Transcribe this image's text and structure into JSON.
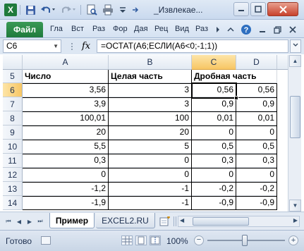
{
  "window": {
    "app_icon_letter": "X",
    "title": "_Извлекае...",
    "controls": {
      "minimize": "—",
      "maximize": "☐",
      "close": "✕"
    }
  },
  "quick_access": {
    "icons": [
      "save-icon",
      "undo-icon",
      "redo-icon",
      "print-preview-icon",
      "print-icon",
      "customize-qat-icon"
    ]
  },
  "ribbon": {
    "file_tab": "Файл",
    "tabs": [
      "Гла",
      "Вст",
      "Раз",
      "Фор",
      "Дая",
      "Рец",
      "Вид",
      "Раз"
    ],
    "right_icons": [
      "ribbon-scroll-icon",
      "help-icon",
      "minimize-ribbon-icon",
      "restore-icon",
      "close-doc-icon"
    ]
  },
  "formula_bar": {
    "name_box": "C6",
    "fx_label": "fx",
    "formula": "=ОСТАТ(A6;ЕСЛИ(A6<0;-1;1))"
  },
  "grid": {
    "columns": [
      "A",
      "B",
      "C",
      "D"
    ],
    "selected_column": "C",
    "selected_row": "6",
    "rows": [
      {
        "num": "5",
        "cells": [
          "Число",
          "Целая часть",
          "Дробная часть",
          ""
        ]
      },
      {
        "num": "6",
        "cells": [
          "3,56",
          "3",
          "0,56",
          "0,56"
        ]
      },
      {
        "num": "7",
        "cells": [
          "3,9",
          "3",
          "0,9",
          "0,9"
        ]
      },
      {
        "num": "8",
        "cells": [
          "100,01",
          "100",
          "0,01",
          "0,01"
        ]
      },
      {
        "num": "9",
        "cells": [
          "20",
          "20",
          "0",
          "0"
        ]
      },
      {
        "num": "10",
        "cells": [
          "5,5",
          "5",
          "0,5",
          "0,5"
        ]
      },
      {
        "num": "11",
        "cells": [
          "0,3",
          "0",
          "0,3",
          "0,3"
        ]
      },
      {
        "num": "12",
        "cells": [
          "0",
          "0",
          "0",
          "0"
        ]
      },
      {
        "num": "13",
        "cells": [
          "-1,2",
          "-1",
          "-0,2",
          "-0,2"
        ]
      },
      {
        "num": "14",
        "cells": [
          "-1,9",
          "-1",
          "-0,9",
          "-0,9"
        ]
      }
    ]
  },
  "sheet_tabs": {
    "tabs": [
      "Пример",
      "EXCEL2.RU"
    ],
    "active": "Пример"
  },
  "status_bar": {
    "ready": "Готово",
    "zoom": "100%",
    "zoom_minus": "−",
    "zoom_plus": "+"
  }
}
